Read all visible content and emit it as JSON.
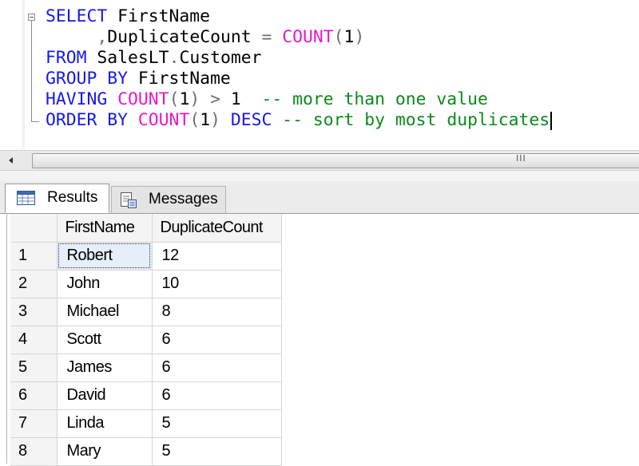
{
  "editor": {
    "lines": [
      [
        {
          "c": "kw",
          "t": "SELECT "
        },
        {
          "c": "tx",
          "t": "FirstName"
        }
      ],
      [
        {
          "c": "tx",
          "t": "     "
        },
        {
          "c": "gr",
          "t": ","
        },
        {
          "c": "tx",
          "t": "DuplicateCount "
        },
        {
          "c": "gr",
          "t": "= "
        },
        {
          "c": "fn",
          "t": "COUNT"
        },
        {
          "c": "gr",
          "t": "("
        },
        {
          "c": "tx",
          "t": "1"
        },
        {
          "c": "gr",
          "t": ")"
        }
      ],
      [
        {
          "c": "kw",
          "t": "FROM "
        },
        {
          "c": "tx",
          "t": "SalesLT"
        },
        {
          "c": "gr",
          "t": "."
        },
        {
          "c": "tx",
          "t": "Customer"
        }
      ],
      [
        {
          "c": "kw",
          "t": "GROUP BY "
        },
        {
          "c": "tx",
          "t": "FirstName"
        }
      ],
      [
        {
          "c": "kw",
          "t": "HAVING "
        },
        {
          "c": "fn",
          "t": "COUNT"
        },
        {
          "c": "gr",
          "t": "("
        },
        {
          "c": "tx",
          "t": "1"
        },
        {
          "c": "gr",
          "t": ") > "
        },
        {
          "c": "tx",
          "t": "1  "
        },
        {
          "c": "cm",
          "t": "-- more than one value"
        }
      ],
      [
        {
          "c": "kw",
          "t": "ORDER BY "
        },
        {
          "c": "fn",
          "t": "COUNT"
        },
        {
          "c": "gr",
          "t": "("
        },
        {
          "c": "tx",
          "t": "1"
        },
        {
          "c": "gr",
          "t": ") "
        },
        {
          "c": "kw",
          "t": "DESC "
        },
        {
          "c": "cm",
          "t": "-- sort by most duplicates"
        }
      ]
    ]
  },
  "scrollbar": {
    "grip": "III"
  },
  "tabs": {
    "results_label": "Results",
    "messages_label": "Messages"
  },
  "grid": {
    "columns": [
      "FirstName",
      "DuplicateCount"
    ],
    "rows": [
      {
        "num": "1",
        "first_name": "Robert",
        "count": "12"
      },
      {
        "num": "2",
        "first_name": "John",
        "count": "10"
      },
      {
        "num": "3",
        "first_name": "Michael",
        "count": "8"
      },
      {
        "num": "4",
        "first_name": "Scott",
        "count": "6"
      },
      {
        "num": "5",
        "first_name": "James",
        "count": "6"
      },
      {
        "num": "6",
        "first_name": "David",
        "count": "6"
      },
      {
        "num": "7",
        "first_name": "Linda",
        "count": "5"
      },
      {
        "num": "8",
        "first_name": "Mary",
        "count": "5"
      }
    ]
  },
  "colors": {
    "keyword": "#1818e6",
    "function": "#e619c8",
    "comment": "#0a8a1a",
    "operator": "#6e6e6e"
  }
}
